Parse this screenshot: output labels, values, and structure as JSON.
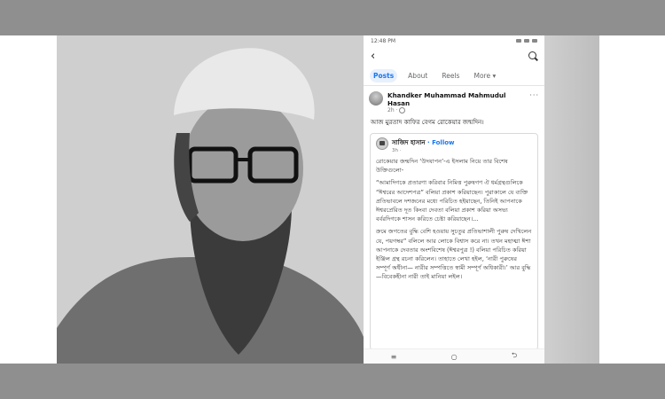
{
  "status": {
    "time": "12:48 PM"
  },
  "tabs": [
    {
      "label": "Posts"
    },
    {
      "label": "About"
    },
    {
      "label": "Reels"
    },
    {
      "label": "More ▾"
    }
  ],
  "post": {
    "author": "Khandker Muhammad Mahmudul Hasan",
    "time": "2h ·",
    "more": "···",
    "text": "আজ মুরতাদ কাফির বেগম রোকেয়ার জন্মদিন।"
  },
  "shared": {
    "name": "সাজিদ হাসান",
    "follow": "· Follow",
    "time": "3h ·",
    "intro": "রোকেয়ার জন্মদিন ‘উদযাপন’-এ ইসলাম নিয়ে তার বিশেষ উক্তিগুলো-",
    "quote1": "“আমাদিগকে প্রতারণা করিবার নিমিত্ত পুরুষগণ ঐ ধর্মগ্রন্থগুলিকে “ঈশ্বরের আদেশপত্র” বলিয়া প্রকাশ করিয়াছেন। পুরাকালে যে ব্যক্তি প্রতিভাবলে দশজনের মধ্যে পরিচিত হইয়াছেন, তিনিই আপনাকে ঈশ্বরপ্রেরিত দূত কিংবা দেবতা বলিয়া প্রকাশ করিয়া অসভ্য বর্বরদিগকে শাসন করিতে চেষ্টা করিয়াছেন।...",
    "quote2": "ক্রমে জগতের বুদ্ধি বেশি হওয়ায় সুচতুর প্রতিভাশালী পুরুষ দেখিলেন যে, পয়গম্বর” বলিলে আর লোকে বিশ্বাস করে না। তখন মহাত্মা ঈশা আপনাকে দেবতার অংশবিশেষ (ঈশ্বরপুত্র !) বলিয়া পরিচিত করিয়া ইঞ্জিল গ্রন্থ রচনা করিলেন। তাহাতে লেখা হইল, ‘নারী পুরুষের সম্পূর্ণ অধীনা— নারীর সম্পত্তিতে স্বামী সম্পূর্ণ অধিকারী।’ আর বুদ্ধি—বিবেকহীনা নারী তাই মানিয়া লইল।"
  },
  "nav": {
    "menu": "≡",
    "home": "○",
    "back": "⮌"
  }
}
